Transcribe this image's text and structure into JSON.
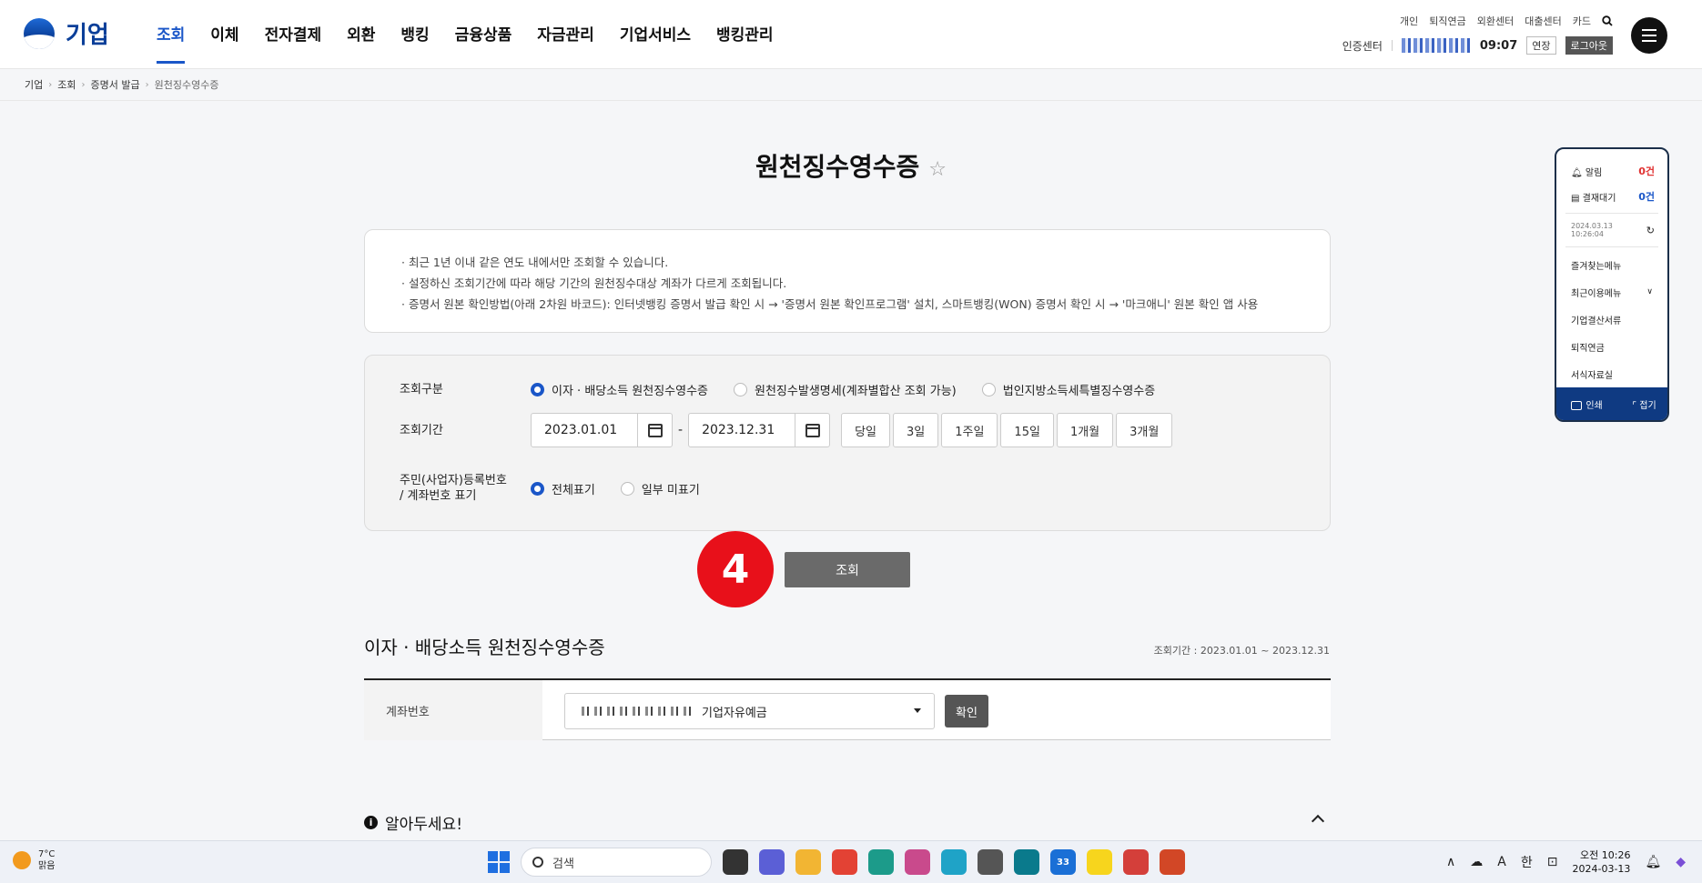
{
  "header": {
    "logo_text": "기업",
    "nav": [
      "조회",
      "이체",
      "전자결제",
      "외환",
      "뱅킹",
      "금융상품",
      "자금관리",
      "기업서비스",
      "뱅킹관리"
    ],
    "util_links": [
      "개인",
      "퇴직연금",
      "외환센터",
      "대출센터",
      "카드"
    ],
    "cert_center": "인증센터",
    "timer": "09:07",
    "extend": "연장",
    "logout": "로그아웃"
  },
  "breadcrumb": [
    "기업",
    "조회",
    "증명서 발급",
    "원천징수영수증"
  ],
  "page": {
    "title": "원천징수영수증",
    "notices": [
      "최근 1년 이내 같은 연도 내에서만 조회할 수 있습니다.",
      "설정하신 조회기간에 따라 해당 기간의 원천징수대상 계좌가 다르게 조회됩니다.",
      "증명서 원본 확인방법(아래 2차원 바코드): 인터넷뱅킹 증명서 발급 확인 시 → '증명서 원본 확인프로그램' 설치, 스마트뱅킹(WON) 증명서 확인 시 → '마크애니' 원본 확인 앱 사용"
    ]
  },
  "search": {
    "type_label": "조회구분",
    "type_options": [
      "이자 · 배당소득 원천징수영수증",
      "원천징수발생명세(계좌별합산 조회 가능)",
      "법인지방소득세특별징수영수증"
    ],
    "period_label": "조회기간",
    "start_date": "2023.01.01",
    "end_date": "2023.12.31",
    "dash": "-",
    "period_buttons": [
      "당일",
      "3일",
      "1주일",
      "15일",
      "1개월",
      "3개월"
    ],
    "display_label_1": "주민(사업자)등록번호",
    "display_label_2": "/ 계좌번호 표기",
    "display_options": [
      "전체표기",
      "일부 미표기"
    ],
    "button": "조회",
    "step": "4"
  },
  "result": {
    "title": "이자 · 배당소득 원천징수영수증",
    "period": "조회기간 : 2023.01.01 ~ 2023.12.31",
    "account_label": "계좌번호",
    "account_type": "기업자유예금",
    "confirm": "확인"
  },
  "notice2": {
    "info": "i",
    "title": "알아두세요!"
  },
  "side_panel": {
    "alert_label": "알림",
    "alert_count": "0건",
    "approval_label": "결재대기",
    "approval_count": "0건",
    "timestamp": "2024.03.13 10:26:04",
    "items": [
      "즐겨찾는메뉴",
      "최근이용메뉴",
      "기업결산서류",
      "퇴직연금",
      "서식자료실"
    ],
    "print": "인쇄",
    "fold": "접기"
  },
  "taskbar": {
    "temp": "7°C",
    "weather": "맑음",
    "search": "검색",
    "badge_33": "33",
    "ime": "한",
    "time": "오전 10:26",
    "date": "2024-03-13"
  }
}
